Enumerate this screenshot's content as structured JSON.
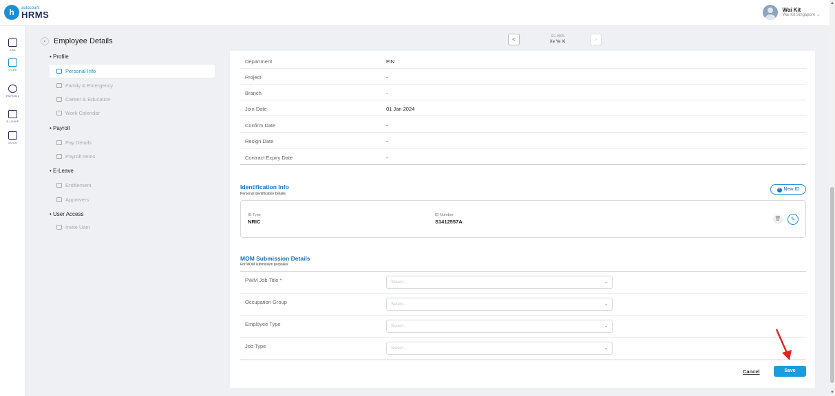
{
  "brand": {
    "small": "autocount",
    "big": "HRMS",
    "mark": "h"
  },
  "user": {
    "name": "Wai Kit",
    "company": "Wai Kit Singapore"
  },
  "rail": [
    {
      "label": "ESS",
      "icon": "ess-icon"
    },
    {
      "label": "CORE",
      "icon": "core-icon",
      "active": true
    },
    {
      "label": "PAYROLL",
      "icon": "payroll-icon"
    },
    {
      "label": "E-LEAVE",
      "icon": "eleave-icon"
    },
    {
      "label": "DOCS",
      "icon": "docs-icon"
    }
  ],
  "header": {
    "title": "Employee Details",
    "employee_id": "SG-0005",
    "employee_name": "Xe Ye Xi"
  },
  "section_nav": {
    "profile": "Profile",
    "personal_info": "Personal Info",
    "family_emergency": "Family & Emergency",
    "career_education": "Career & Education",
    "work_calendar": "Work Calendar",
    "payroll": "Payroll",
    "pay_details": "Pay Details",
    "payroll_items": "Payroll Items",
    "eleave": "E-Leave",
    "entitlement": "Entitlement",
    "approvers": "Approvers",
    "user_access": "User Access",
    "invite_user": "Invite User"
  },
  "details": [
    {
      "label": "Department",
      "value": "FIN"
    },
    {
      "label": "Project",
      "value": "-"
    },
    {
      "label": "Branch",
      "value": "-"
    },
    {
      "label": "Join Date",
      "value": "01 Jan 2024"
    },
    {
      "label": "Confirm Date",
      "value": "-"
    },
    {
      "label": "Resign Date",
      "value": "-"
    },
    {
      "label": "Contract Expiry Date",
      "value": "-"
    }
  ],
  "identification": {
    "title": "Identification Info",
    "subtitle": "Personal Identification Details",
    "new_button": "New ID",
    "id_type_label": "ID Type",
    "id_type_value": "NRIC",
    "id_number_label": "ID Number",
    "id_number_value": "S1412557A"
  },
  "mom": {
    "title": "MOM Submission Details",
    "subtitle": "For MOM submission purposes",
    "fields": [
      {
        "label": "PWM Job Title",
        "required_mark": "*",
        "placeholder": "Select..."
      },
      {
        "label": "Occupation Group",
        "placeholder": "Select..."
      },
      {
        "label": "Employee Type",
        "placeholder": "Select..."
      },
      {
        "label": "Job Type",
        "placeholder": "Select..."
      }
    ]
  },
  "actions": {
    "cancel": "Cancel",
    "save": "Save"
  },
  "colors": {
    "accent": "#1b8fd6",
    "save": "#1b9be0",
    "arrow": "#e02424"
  }
}
